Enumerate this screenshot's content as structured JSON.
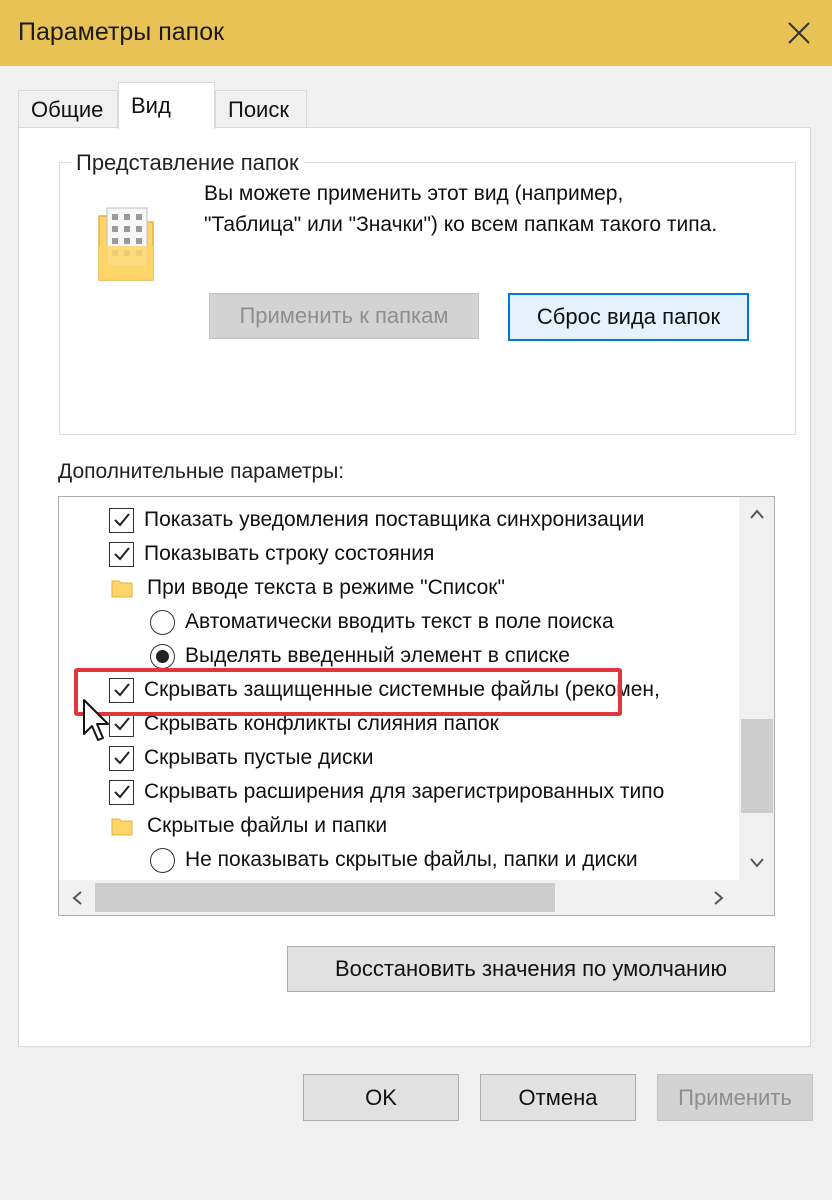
{
  "window": {
    "title": "Параметры папок"
  },
  "tabs": [
    {
      "label": "Общие"
    },
    {
      "label": "Вид"
    },
    {
      "label": "Поиск"
    }
  ],
  "folder_views": {
    "legend": "Представление папок",
    "description": "Вы можете применить этот вид (например, \"Таблица\" или \"Значки\") ко всем папкам такого типа.",
    "apply_button": "Применить к папкам",
    "reset_button": "Сброс вида папок"
  },
  "advanced": {
    "label": "Дополнительные параметры:",
    "items": [
      {
        "kind": "checkbox",
        "checked": true,
        "text": "Показать уведомления поставщика синхронизации"
      },
      {
        "kind": "checkbox",
        "checked": true,
        "text": "Показывать строку состояния"
      },
      {
        "kind": "folder",
        "text": "При вводе текста в режиме \"Список\""
      },
      {
        "kind": "radio",
        "checked": false,
        "text": "Автоматически вводить текст в поле поиска"
      },
      {
        "kind": "radio",
        "checked": true,
        "text": "Выделять введенный элемент в списке"
      },
      {
        "kind": "checkbox",
        "checked": true,
        "text": "Скрывать защищенные системные файлы (рекомен,"
      },
      {
        "kind": "checkbox",
        "checked": true,
        "text": "Скрывать конфликты слияния папок"
      },
      {
        "kind": "checkbox",
        "checked": true,
        "text": "Скрывать пустые диски"
      },
      {
        "kind": "checkbox",
        "checked": true,
        "text": "Скрывать расширения для зарегистрированных типо"
      },
      {
        "kind": "folder",
        "text": "Скрытые файлы и папки"
      },
      {
        "kind": "radio",
        "checked": false,
        "text": "Не показывать скрытые файлы, папки и диски"
      }
    ],
    "restore_button": "Восстановить значения по умолчанию"
  },
  "buttons": {
    "ok": "OK",
    "cancel": "Отмена",
    "apply": "Применить"
  },
  "icons": {
    "close": "close-icon",
    "folder": "folder-icon",
    "checkmark": "checkmark-icon",
    "scroll_up": "chevron-up-icon",
    "scroll_down": "chevron-down-icon",
    "scroll_left": "chevron-left-icon",
    "scroll_right": "chevron-right-icon",
    "cursor": "mouse-pointer-icon"
  },
  "colors": {
    "titlebar": "#e9c255",
    "highlight": "#e0353a",
    "focus": "#0078d7",
    "folder": "#ffd56a"
  }
}
